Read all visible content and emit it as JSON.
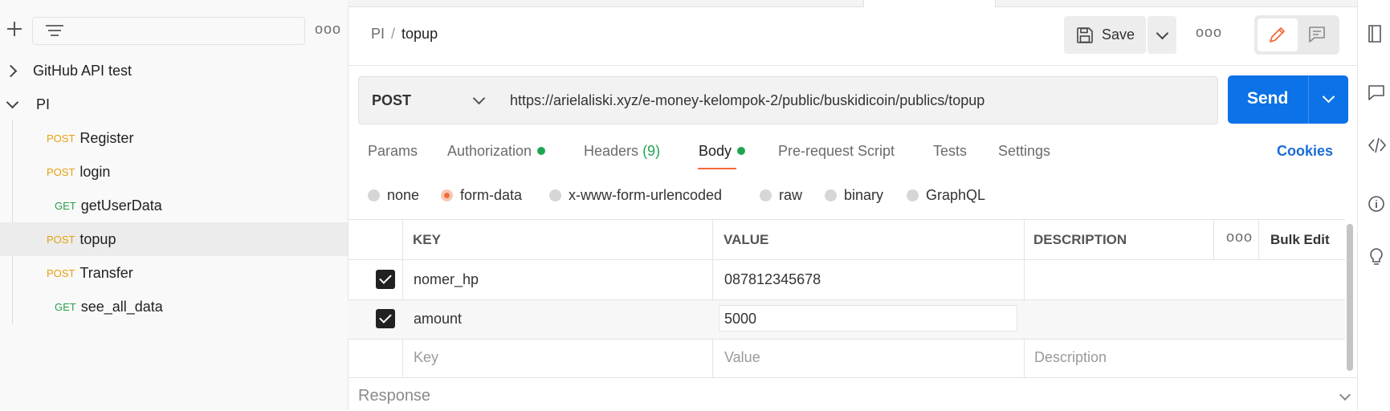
{
  "sidebar": {
    "filter_placeholder": "",
    "more_label": "ooo",
    "items": [
      {
        "label": "GitHub API test",
        "method": "",
        "kind": "folder",
        "expanded": false
      },
      {
        "label": "PI",
        "method": "",
        "kind": "folder",
        "expanded": true
      },
      {
        "label": "Register",
        "method": "POST"
      },
      {
        "label": "login",
        "method": "POST"
      },
      {
        "label": "getUserData",
        "method": "GET"
      },
      {
        "label": "topup",
        "method": "POST",
        "selected": true
      },
      {
        "label": "Transfer",
        "method": "POST"
      },
      {
        "label": "see_all_data",
        "method": "GET"
      }
    ]
  },
  "header": {
    "breadcrumb_parent": "PI",
    "breadcrumb_sep": "/",
    "breadcrumb_current": "topup",
    "save_label": "Save",
    "more_label": "ooo"
  },
  "request": {
    "method": "POST",
    "url": "https://arielaliski.xyz/e-money-kelompok-2/public/buskidicoin/publics/topup",
    "send_label": "Send"
  },
  "tabs": [
    {
      "label": "Params"
    },
    {
      "label": "Authorization",
      "dot": true
    },
    {
      "label": "Headers",
      "count": "(9)"
    },
    {
      "label": "Body",
      "dot": true,
      "active": true
    },
    {
      "label": "Pre-request Script"
    },
    {
      "label": "Tests"
    },
    {
      "label": "Settings"
    }
  ],
  "cookies_label": "Cookies",
  "body_types": [
    {
      "label": "none"
    },
    {
      "label": "form-data",
      "selected": true
    },
    {
      "label": "x-www-form-urlencoded"
    },
    {
      "label": "raw"
    },
    {
      "label": "binary"
    },
    {
      "label": "GraphQL"
    }
  ],
  "table": {
    "headers": {
      "key": "KEY",
      "value": "VALUE",
      "description": "DESCRIPTION",
      "more": "ooo",
      "bulk": "Bulk Edit"
    },
    "rows": [
      {
        "key": "nomer_hp",
        "value": "087812345678",
        "checked": true
      },
      {
        "key": "amount",
        "value": "5000",
        "checked": true
      }
    ],
    "placeholders": {
      "key": "Key",
      "value": "Value",
      "description": "Description"
    }
  },
  "response_label": "Response",
  "colors": {
    "accent": "#0b72e7",
    "post": "#e5a00d",
    "get": "#2a9d4a",
    "active_underline": "#f26b3a",
    "dot": "#1fa552"
  }
}
